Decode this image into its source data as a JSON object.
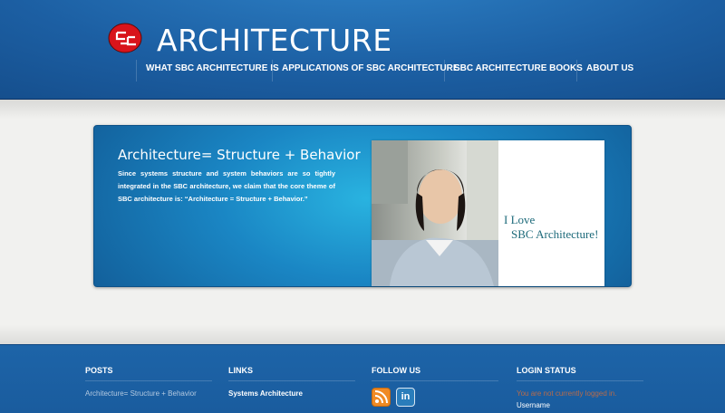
{
  "header": {
    "site_title": "ARCHITECTURE",
    "logo_icon": "sbc-logo-icon"
  },
  "nav": {
    "items": [
      {
        "label": "WHAT SBC ARCHITECTURE IS"
      },
      {
        "label": "APPLICATIONS OF SBC ARCHITECTURE"
      },
      {
        "label": "SBC ARCHITECTURE BOOKS"
      },
      {
        "label": "ABOUT US"
      }
    ]
  },
  "feature": {
    "heading": "Architecture= Structure + Behavior",
    "text": "Since systems structure and system behaviors are so tightly integrated in the SBC architecture, we claim that the core theme of SBC architecture is: “Architecture = Structure + Behavior.”",
    "photo_caption_line1": "I  Love",
    "photo_caption_line2": "SBC Architecture!"
  },
  "footer": {
    "posts": {
      "title": "POSTS",
      "items": [
        "Architecture= Structure + Behavior"
      ]
    },
    "links": {
      "title": "LINKS",
      "items": [
        "Systems Architecture"
      ]
    },
    "follow": {
      "title": "FOLLOW US",
      "icons": [
        "rss-icon",
        "linkedin-icon"
      ],
      "linkedin_glyph": "in"
    },
    "login": {
      "title": "LOGIN STATUS",
      "message": "You are not currently logged in.",
      "username_label": "Username"
    }
  },
  "colors": {
    "header_blue": "#1c5fa3",
    "feature_blue": "#1a86c4",
    "footer_blue": "#1a5c9e",
    "caption_teal": "#1d6a7a",
    "rss_orange": "#f08a24"
  }
}
